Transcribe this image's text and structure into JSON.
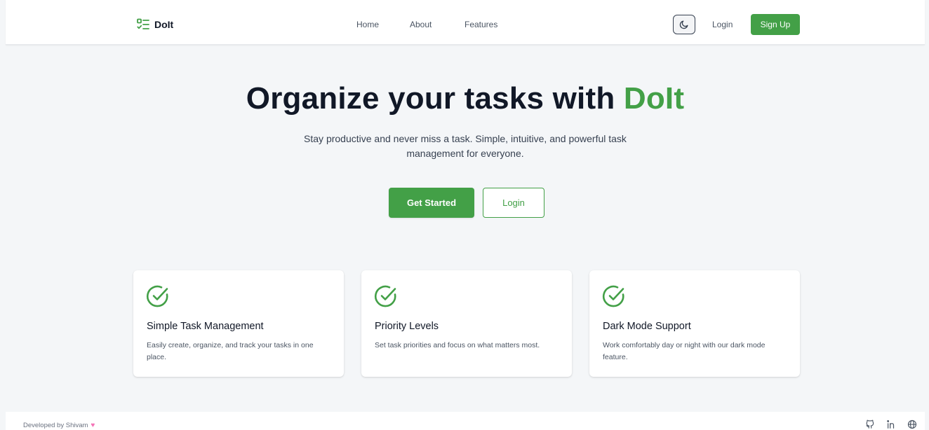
{
  "header": {
    "logo_text": "DoIt",
    "nav": [
      {
        "label": "Home"
      },
      {
        "label": "About"
      },
      {
        "label": "Features"
      }
    ],
    "login_label": "Login",
    "signup_label": "Sign Up",
    "theme_toggle_icon": "moon-icon"
  },
  "hero": {
    "title_prefix": "Organize your tasks with",
    "title_brand": "DoIt",
    "subtitle": "Stay productive and never miss a task. Simple, intuitive, and powerful task management for everyone.",
    "primary_label": "Get Started",
    "secondary_label": "Login"
  },
  "features": [
    {
      "icon": "check-circle-icon",
      "title": "Simple Task Management",
      "description": "Easily create, organize, and track your tasks in one place."
    },
    {
      "icon": "check-circle-icon",
      "title": "Priority Levels",
      "description": "Set task priorities and focus on what matters most."
    },
    {
      "icon": "check-circle-icon",
      "title": "Dark Mode Support",
      "description": "Work comfortably day or night with our dark mode feature."
    }
  ],
  "footer": {
    "credit": "Developed by Shivam",
    "icons": [
      "github-icon",
      "linkedin-icon",
      "globe-icon"
    ]
  },
  "colors": {
    "accent": "#43a047",
    "background": "#f4f6f8",
    "text": "#111827"
  }
}
